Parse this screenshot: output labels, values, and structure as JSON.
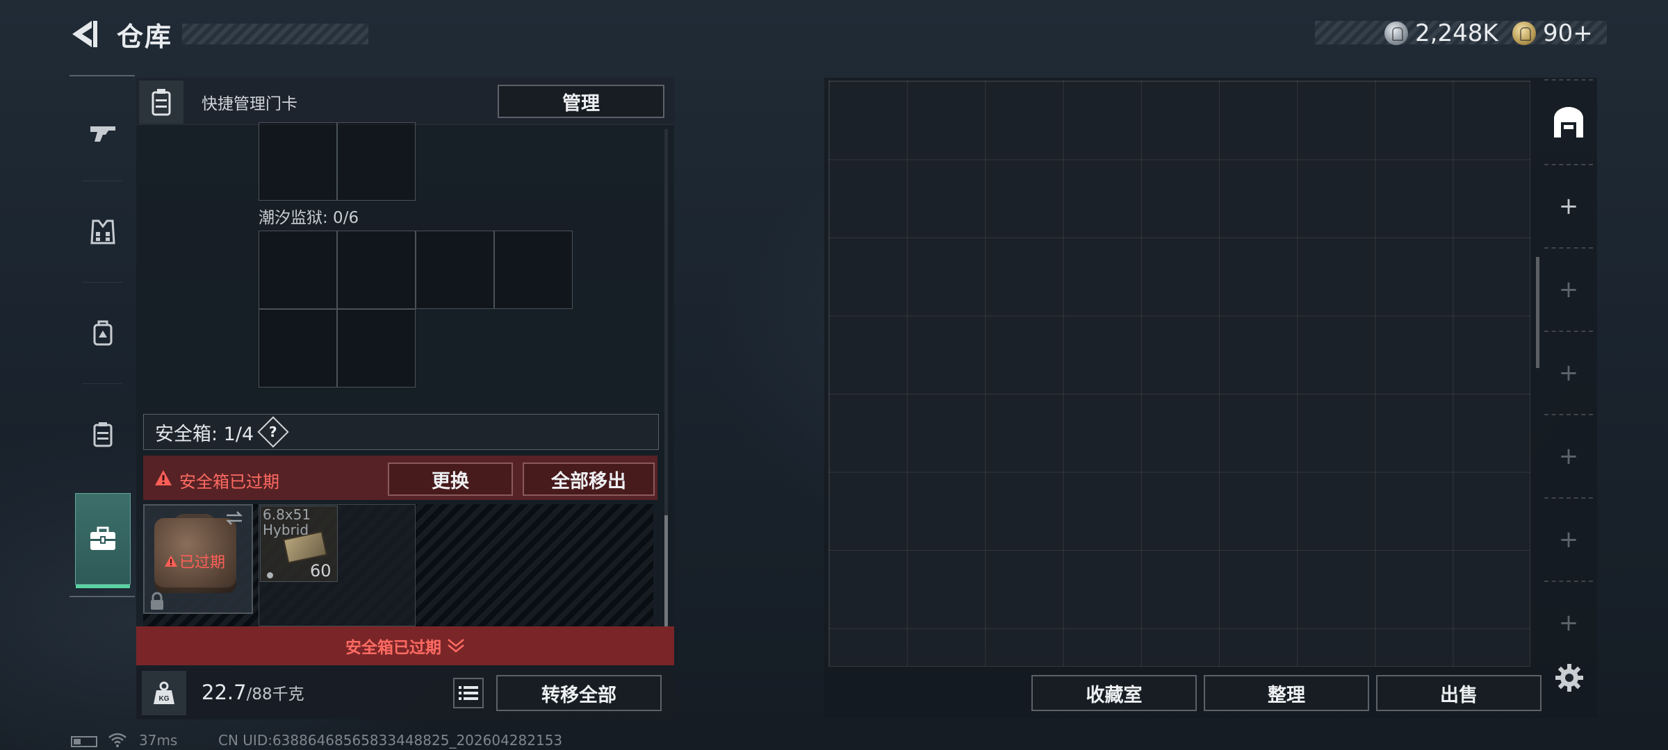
{
  "header": {
    "title": "仓库",
    "currency": [
      {
        "icon": "silver-coin-icon",
        "value": "2,248K"
      },
      {
        "icon": "gold-coin-icon",
        "value": "90+"
      }
    ]
  },
  "rail": {
    "items": [
      {
        "name": "weapons",
        "icon": "pistol-icon"
      },
      {
        "name": "armor",
        "icon": "vest-icon"
      },
      {
        "name": "backpack",
        "icon": "backpack-icon"
      },
      {
        "name": "keycard",
        "icon": "keycard-case-icon"
      },
      {
        "name": "safebox",
        "icon": "briefcase-icon",
        "active": true
      }
    ]
  },
  "left_panel": {
    "header_label": "快捷管理门卡",
    "manage_label": "管理",
    "section_label": "潮汐监狱: 0/6",
    "safebox_label": "安全箱: 1/4",
    "help_label": "?",
    "expired_notice": "安全箱已过期",
    "replace_label": "更换",
    "move_all_label": "全部移出",
    "box_expired_tag": "已过期",
    "ammo": {
      "name_line1": "6.8x51",
      "name_line2": "Hybrid",
      "count": "60"
    },
    "expired_banner": "安全箱已过期",
    "weight_value": "22.7",
    "weight_capacity": "/88千克",
    "transfer_all_label": "转移全部"
  },
  "right_panel": {
    "vault_label": "收藏室",
    "sort_label": "整理",
    "sell_label": "出售",
    "side_tabs": [
      "+",
      "+",
      "+",
      "+",
      "+",
      "+"
    ]
  },
  "status": {
    "ping": "37ms",
    "uid": "CN UID:638864685658334488​25_202604282153"
  },
  "colors": {
    "accent_green": "#58d3a2",
    "warning_red": "#ff6b63",
    "expired_bg": "#7a2628"
  }
}
